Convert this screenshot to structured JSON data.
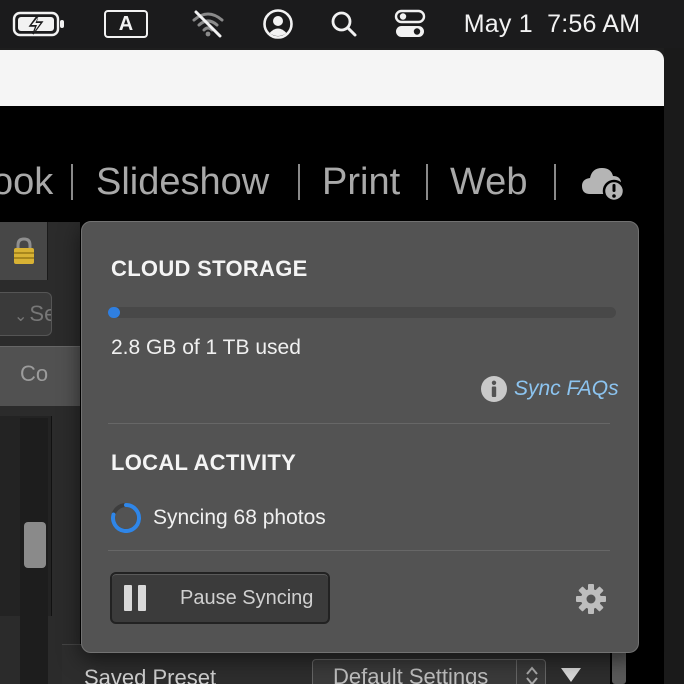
{
  "menubar": {
    "input_source": "A",
    "date": "May 1",
    "time": "7:56 AM",
    "icons": [
      "battery-charging-icon",
      "wifi-off-icon",
      "user-account-icon",
      "search-icon",
      "control-center-icon"
    ]
  },
  "modules": {
    "book": "ook",
    "slideshow": "Slideshow",
    "print": "Print",
    "web": "Web",
    "separator": "|"
  },
  "left_panel": {
    "search_placeholder": "Sea",
    "row_label": "Co"
  },
  "preset": {
    "label": "Saved Preset",
    "value": "Default Settings"
  },
  "sync_popover": {
    "cloud_storage": {
      "heading": "CLOUD STORAGE",
      "used_text": "2.8 GB of 1 TB used",
      "used_fraction": 0.0028,
      "faq_label": "Sync FAQs"
    },
    "local_activity": {
      "heading": "LOCAL ACTIVITY",
      "status": "Syncing 68 photos"
    },
    "pause_button": "Pause Syncing"
  },
  "colors": {
    "accent_blue": "#2f7fe0",
    "link_blue": "#8cc4f0",
    "popover_bg": "#535353"
  }
}
